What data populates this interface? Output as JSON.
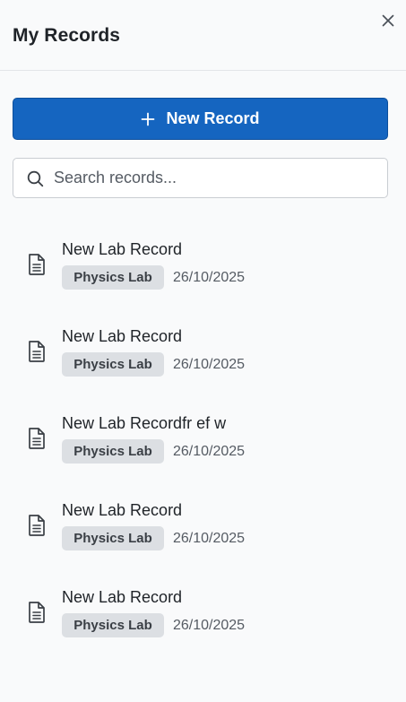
{
  "header": {
    "title": "My Records",
    "close_icon": "close-icon"
  },
  "new_record": {
    "label": "New Record",
    "icon": "plus-icon"
  },
  "search": {
    "placeholder": "Search records...",
    "value": "",
    "icon": "search-icon"
  },
  "records": [
    {
      "name": "New Lab Record",
      "tag": "Physics Lab",
      "date": "26/10/2025",
      "icon": "document-icon"
    },
    {
      "name": "New Lab Record",
      "tag": "Physics Lab",
      "date": "26/10/2025",
      "icon": "document-icon"
    },
    {
      "name": "New Lab Recordfr ef w",
      "tag": "Physics Lab",
      "date": "26/10/2025",
      "icon": "document-icon"
    },
    {
      "name": "New Lab Record",
      "tag": "Physics Lab",
      "date": "26/10/2025",
      "icon": "document-icon"
    },
    {
      "name": "New Lab Record",
      "tag": "Physics Lab",
      "date": "26/10/2025",
      "icon": "document-icon"
    }
  ],
  "colors": {
    "accent": "#1565c0",
    "badge_bg": "#dcdfe3",
    "background": "#f9fafb"
  }
}
